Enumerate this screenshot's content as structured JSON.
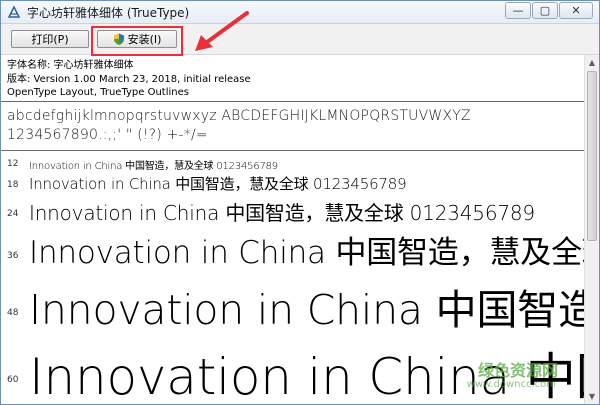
{
  "window": {
    "title": "字心坊轩雅体细体 (TrueType)",
    "controls": {
      "minimize": "—",
      "maximize": "▢",
      "close": "✕"
    }
  },
  "toolbar": {
    "print_label": "打印(P)",
    "install_label": "安装(I)"
  },
  "info": {
    "font_name": "字体名称: 字心坊轩雅体细体",
    "version": "版本: Version 1.00 March 23, 2018, initial release",
    "outlines": "OpenType Layout, TrueType Outlines"
  },
  "charset": {
    "line1": "abcdefghijklmnopqrstuvwxyz ABCDEFGHIJKLMNOPQRSTUVWXYZ",
    "line2": "1234567890.:,;' \" (!?) +-*/="
  },
  "samples": [
    {
      "size": "12",
      "text": "Innovation in China 中国智造，慧及全球 0123456789"
    },
    {
      "size": "18",
      "text": "Innovation in China 中国智造，慧及全球 0123456789"
    },
    {
      "size": "24",
      "text": "Innovation in China 中国智造，慧及全球 0123456789"
    },
    {
      "size": "36",
      "text": "Innovation in China 中国智造，慧及全球"
    },
    {
      "size": "48",
      "text": "Innovation in China 中国智造，"
    },
    {
      "size": "60",
      "text": "Innovation in China 中国智"
    }
  ],
  "watermark": {
    "top": "绿色资源网",
    "bottom": "www.downcc.com"
  },
  "colors": {
    "highlight": "#e8303a",
    "watermark": "#5caa46"
  }
}
